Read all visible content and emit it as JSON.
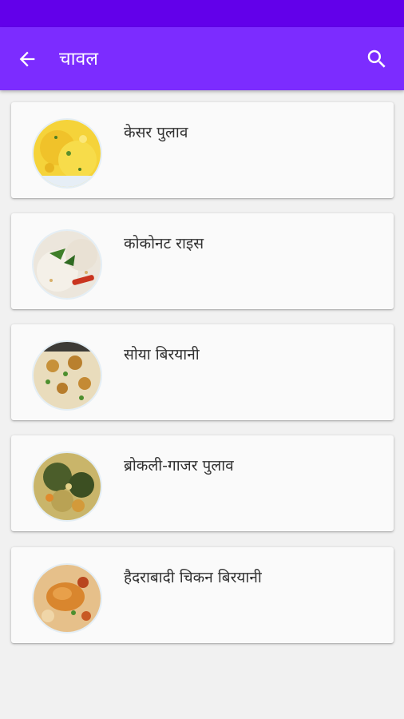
{
  "app_bar": {
    "title": "चावल",
    "back_icon": "arrow-left-icon",
    "search_icon": "search-icon",
    "color": "#7c2cff"
  },
  "status_bar": {
    "color": "#6200ea"
  },
  "recipes": [
    {
      "title": "केसर पुलाव",
      "image": "saffron-pulao-image"
    },
    {
      "title": " कोकोनट राइस",
      "image": "coconut-rice-image"
    },
    {
      "title": "सोया बिरयानी",
      "image": "soya-biryani-image"
    },
    {
      "title": "ब्रोकली-गाजर पुलाव",
      "image": "broccoli-carrot-pulao-image"
    },
    {
      "title": "हैदराबादी चिकन बिरयानी",
      "image": "hyderabadi-chicken-biryani-image"
    }
  ]
}
